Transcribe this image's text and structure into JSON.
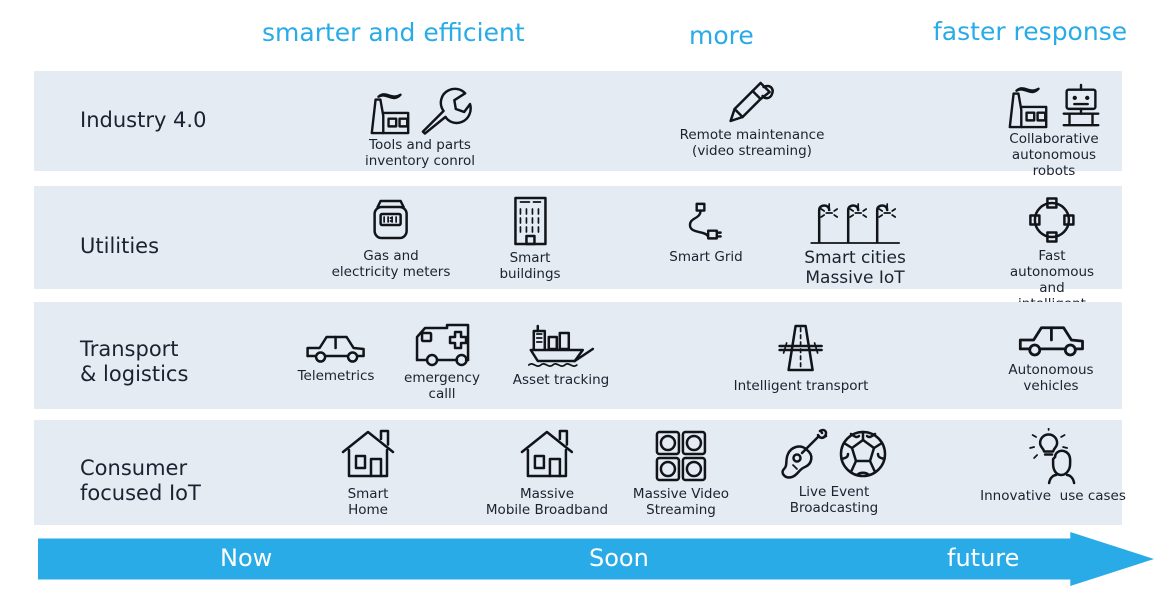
{
  "header": {
    "captions": [
      {
        "id": "smarter",
        "label": "smarter and efficient"
      },
      {
        "id": "more",
        "label": "more"
      },
      {
        "id": "faster",
        "label": "faster response"
      }
    ],
    "accent_color": "#29ABE8"
  },
  "colors": {
    "accent": "#29ABE8",
    "band_background": "#E4EBF2",
    "text": "#1b2230",
    "icon_stroke": "#111418",
    "page_background": "#FFFFFF"
  },
  "rows": [
    {
      "id": "industry",
      "label": "Industry 4.0",
      "cells": [
        {
          "id": "tools-parts-inventory",
          "caption": "Tools and parts\ninventory conrol",
          "icons": [
            "factory-icon",
            "wrench-icon"
          ]
        },
        {
          "id": "remote-maintenance",
          "caption": "Remote maintenance\n(video streaming)",
          "icons": [
            "screwdriver-icon"
          ]
        },
        {
          "id": "collaborative-robots",
          "caption": "Collaborative\nautonomous robots",
          "icons": [
            "factory-icon",
            "robot-icon"
          ]
        }
      ]
    },
    {
      "id": "utilities",
      "label": "Utilities",
      "cells": [
        {
          "id": "gas-electricity-meters",
          "caption": "Gas and\nelectricity meters",
          "icons": [
            "meter-icon"
          ]
        },
        {
          "id": "smart-buildings",
          "caption": "Smart\nbuildings",
          "icons": [
            "office-building-icon"
          ]
        },
        {
          "id": "smart-grid",
          "caption": "Smart Grid",
          "icons": [
            "power-plug-cable-icon"
          ]
        },
        {
          "id": "smart-cities-massive-iot",
          "caption": "Smart cities\nMassive IoT",
          "icons": [
            "street-lamps-icon"
          ]
        },
        {
          "id": "fast-autonomous-grid",
          "caption": "Fast autonomous and\nintelligent grid",
          "icons": [
            "ring-network-icon"
          ]
        }
      ]
    },
    {
      "id": "transport",
      "label": "Transport\n& logistics",
      "cells": [
        {
          "id": "telemetrics",
          "caption": "Telemetrics",
          "icons": [
            "car-icon"
          ]
        },
        {
          "id": "emergency-call",
          "caption": "emergency\ncalll",
          "icons": [
            "ambulance-icon"
          ]
        },
        {
          "id": "asset-tracking",
          "caption": "Asset tracking",
          "icons": [
            "cargo-ship-icon"
          ]
        },
        {
          "id": "intelligent-transport",
          "caption": "Intelligent transport",
          "icons": [
            "highway-icon"
          ]
        },
        {
          "id": "autonomous-vehicles",
          "caption": "Autonomous\nvehicles",
          "icons": [
            "car-icon"
          ]
        }
      ]
    },
    {
      "id": "consumer",
      "label": "Consumer\nfocused IoT",
      "cells": [
        {
          "id": "smart-home",
          "caption": "Smart\nHome",
          "icons": [
            "house-icon"
          ]
        },
        {
          "id": "massive-mobile-broadband",
          "caption": "Massive\nMobile Broadband",
          "icons": [
            "house-icon"
          ]
        },
        {
          "id": "massive-video-streaming",
          "caption": "Massive Video\nStreaming",
          "icons": [
            "four-screens-icon"
          ]
        },
        {
          "id": "live-event-broadcasting",
          "caption": "Live Event\nBroadcasting",
          "icons": [
            "guitar-icon",
            "soccer-ball-icon"
          ]
        },
        {
          "id": "innovative-use-cases",
          "caption": "Innovative  use cases",
          "icons": [
            "idea-person-icon"
          ]
        }
      ]
    }
  ],
  "timeline": {
    "stops": [
      {
        "id": "now",
        "label": "Now"
      },
      {
        "id": "soon",
        "label": "Soon"
      },
      {
        "id": "future",
        "label": "future"
      }
    ],
    "color": "#29ABE8"
  }
}
